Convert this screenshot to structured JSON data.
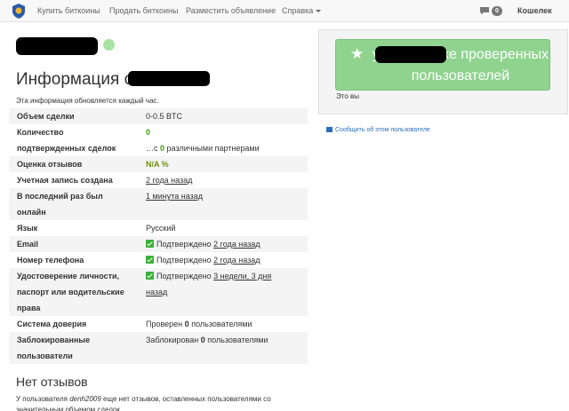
{
  "navbar": {
    "items": [
      "Купить биткоины",
      "Продать биткоины",
      "Разместить объявление",
      "Справка"
    ],
    "messages_count": "0",
    "user_label": "Кошелек"
  },
  "profile": {
    "info_title_prefix": "Информация о",
    "update_note": "Эта информация обновляется каждый час."
  },
  "table": {
    "volume": {
      "label": "Объем сделки",
      "value": "0-0.5 BTC"
    },
    "confirmed": {
      "label_line1": "Количество",
      "label_line2": "подтвержденных сделок",
      "value_main": "0",
      "value_prefix": "…с",
      "value_count": "0",
      "value_suffix": "различными партнерами"
    },
    "rating": {
      "label": "Оценка отзывов",
      "value": "N/A %"
    },
    "created": {
      "label": "Учетная запись создана",
      "value": "2 года назад"
    },
    "last_online": {
      "label_line1": "В последний раз был",
      "label_line2": "онлайн",
      "value": "1 минута назад"
    },
    "language": {
      "label": "Язык",
      "value": "Русский"
    },
    "email": {
      "label": "Email",
      "prefix": "Подтверждено",
      "value": "2 года назад"
    },
    "phone": {
      "label": "Номер телефона",
      "prefix": "Подтверждено",
      "value": "2 года назад"
    },
    "identity": {
      "label_line1": "Удостоверение личности,",
      "label_line2": "паспорт или водительские",
      "label_line3": "права",
      "prefix": "Подтверждено",
      "value_line1": "3 недели, 3 дня",
      "value_line2": "назад"
    },
    "trust": {
      "label": "Система доверия",
      "prefix": "Проверен",
      "count": "0",
      "suffix": "пользователями"
    },
    "blocked": {
      "label_line1": "Заблокированные",
      "label_line2": "пользователи",
      "prefix": "Заблокирован",
      "count": "0",
      "suffix": "пользователями"
    }
  },
  "reviews": {
    "title": "Нет отзывов",
    "text_prefix": "У пользователя",
    "username": "denh2009",
    "text_suffix": "еще нет отзывов, оставленных пользователями со значительным объемом сделок."
  },
  "panel": {
    "trust_text": "уже в списке проверенных пользователей",
    "this_you": "Это вы",
    "report_link": "Сообщить об этом пользователе"
  },
  "colors": {
    "trust_button": "#8fd38f",
    "online_dot": "#a7e3a1",
    "confirmed_green": "#3c9b00",
    "link_blue": "#2a6fbd"
  }
}
